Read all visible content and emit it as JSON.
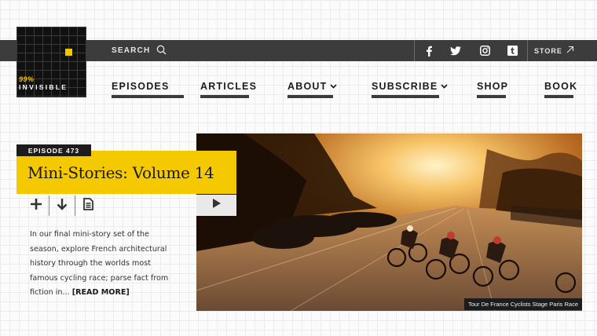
{
  "logo": {
    "number": "99%",
    "word": "INVISIBLE"
  },
  "topbar": {
    "search_label": "SEARCH",
    "social": [
      "facebook-icon",
      "twitter-icon",
      "instagram-icon",
      "tumblr-icon"
    ],
    "store_label": "STORE"
  },
  "nav": {
    "episodes": "EPISODES",
    "articles": "ARTICLES",
    "about": "ABOUT",
    "subscribe": "SUBSCRIBE",
    "shop": "SHOP",
    "book": "BOOK"
  },
  "episode": {
    "label": "EPISODE 473",
    "title": "Mini-Stories: Volume 14",
    "description": "In our final mini-story set of the season, explore French architectural history through the worlds most famous cycling race; parse fact from fiction in... ",
    "read_more": "[READ MORE]",
    "actions": [
      "plus-icon",
      "download-icon",
      "document-icon"
    ]
  },
  "hero": {
    "caption": "Tour De France Cyclists Stage Paris Race",
    "play": "play-icon"
  },
  "colors": {
    "accent": "#f5c900",
    "bar": "#3c3c3c",
    "dark": "#1c1c1c"
  }
}
